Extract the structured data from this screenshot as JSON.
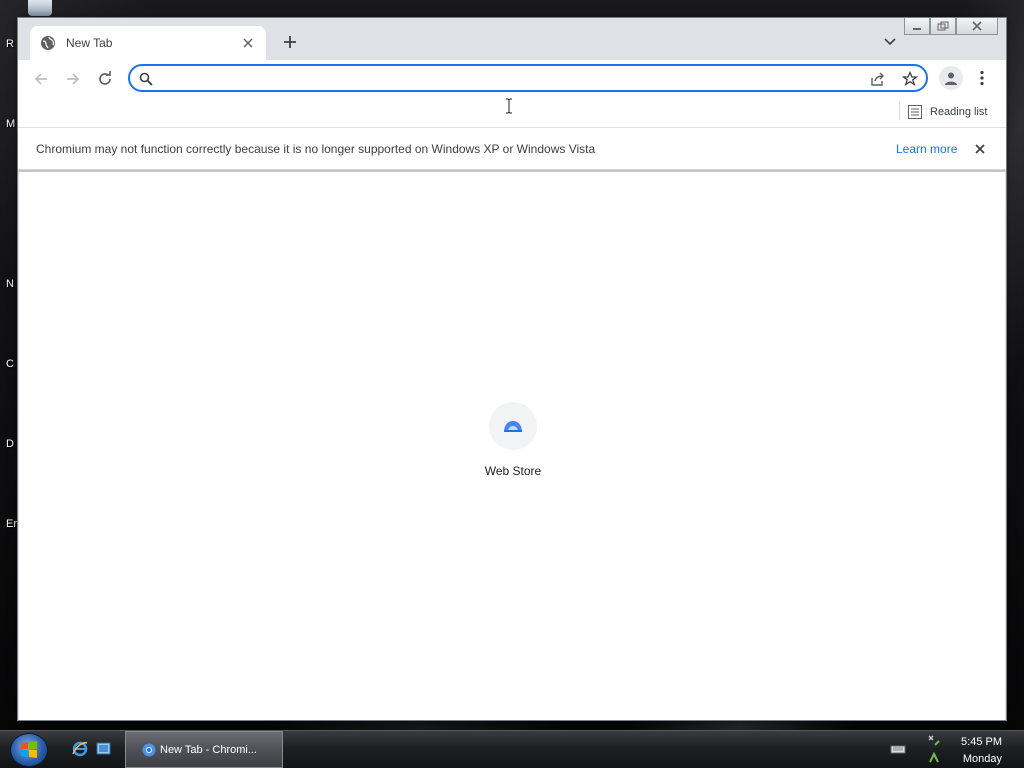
{
  "desktop": {
    "side_labels": [
      "R",
      "M",
      "N",
      "C",
      "D",
      "Er"
    ]
  },
  "window": {
    "controls": {
      "minimize": "minimize",
      "maximize": "maximize",
      "close": "close"
    }
  },
  "tabs": [
    {
      "title": "New Tab",
      "favicon": "globe-icon"
    }
  ],
  "toolbar": {
    "omnibox_value": "",
    "omnibox_placeholder": ""
  },
  "bookmarks_bar": {
    "reading_list_label": "Reading list"
  },
  "infobar": {
    "message": "Chromium may not function correctly because it is no longer supported on Windows XP or Windows Vista",
    "link_label": "Learn more"
  },
  "new_tab_page": {
    "shortcuts": [
      {
        "label": "Web Store",
        "icon": "web-store-icon"
      }
    ]
  },
  "taskbar": {
    "active_task_label": "New Tab - Chromi...",
    "clock_time": "5:45 PM",
    "clock_day": "Monday"
  },
  "colors": {
    "accent": "#1a73e8",
    "tabstrip": "#dee1e6"
  }
}
